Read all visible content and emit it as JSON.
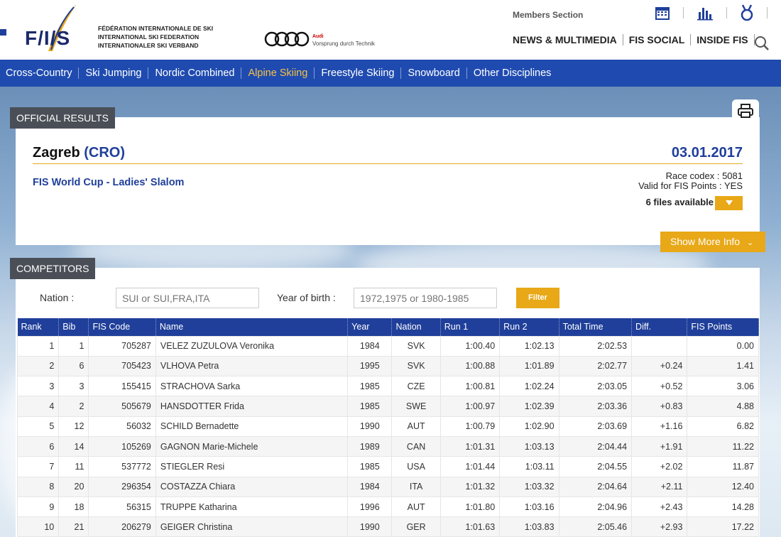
{
  "header": {
    "federation_lines": [
      "FÉDÉRATION INTERNATIONALE DE SKI",
      "INTERNATIONAL SKI FEDERATION",
      "INTERNATIONALER SKI VERBAND"
    ],
    "logo_text": "F/I/S",
    "sponsor_brand": "Audi",
    "sponsor_tagline": "Vorsprung durch Technik",
    "members_section": "Members Section",
    "nav": [
      "NEWS & MULTIMEDIA",
      "FIS SOCIAL",
      "INSIDE FIS"
    ],
    "icons": [
      "calendar-icon",
      "bar-chart-icon",
      "medal-icon",
      "user-icon",
      "search-icon"
    ]
  },
  "disciplines": [
    {
      "label": "Cross-Country",
      "active": false
    },
    {
      "label": "Ski Jumping",
      "active": false
    },
    {
      "label": "Nordic Combined",
      "active": false
    },
    {
      "label": "Alpine Skiing",
      "active": true
    },
    {
      "label": "Freestyle Skiing",
      "active": false
    },
    {
      "label": "Snowboard",
      "active": false
    },
    {
      "label": "Other Disciplines",
      "active": false
    }
  ],
  "official": {
    "tab": "OFFICIAL RESULTS",
    "place": "Zagreb",
    "country": "(CRO)",
    "date": "03.01.2017",
    "event": "FIS World Cup - Ladies' Slalom",
    "codex": "Race codex : 5081",
    "valid": "Valid for FIS Points : YES",
    "files": "6 files available",
    "more": "Show More Info"
  },
  "competitors": {
    "tab": "COMPETITORS",
    "nation_label": "Nation :",
    "nation_placeholder": "SUI or SUI,FRA,ITA",
    "yob_label": "Year of birth :",
    "yob_placeholder": "1972,1975 or 1980-1985",
    "filter": "Filter",
    "columns": [
      "Rank",
      "Bib",
      "FIS Code",
      "Name",
      "Year",
      "Nation",
      "Run 1",
      "Run 2",
      "Total Time",
      "Diff.",
      "FIS Points"
    ],
    "rows": [
      [
        "1",
        "1",
        "705287",
        "VELEZ ZUZULOVA Veronika",
        "1984",
        "SVK",
        "1:00.40",
        "1:02.13",
        "2:02.53",
        "",
        "0.00"
      ],
      [
        "2",
        "6",
        "705423",
        "VLHOVA Petra",
        "1995",
        "SVK",
        "1:00.88",
        "1:01.89",
        "2:02.77",
        "+0.24",
        "1.41"
      ],
      [
        "3",
        "3",
        "155415",
        "STRACHOVA Sarka",
        "1985",
        "CZE",
        "1:00.81",
        "1:02.24",
        "2:03.05",
        "+0.52",
        "3.06"
      ],
      [
        "4",
        "2",
        "505679",
        "HANSDOTTER Frida",
        "1985",
        "SWE",
        "1:00.97",
        "1:02.39",
        "2:03.36",
        "+0.83",
        "4.88"
      ],
      [
        "5",
        "12",
        "56032",
        "SCHILD Bernadette",
        "1990",
        "AUT",
        "1:00.79",
        "1:02.90",
        "2:03.69",
        "+1.16",
        "6.82"
      ],
      [
        "6",
        "14",
        "105269",
        "GAGNON Marie-Michele",
        "1989",
        "CAN",
        "1:01.31",
        "1:03.13",
        "2:04.44",
        "+1.91",
        "11.22"
      ],
      [
        "7",
        "11",
        "537772",
        "STIEGLER Resi",
        "1985",
        "USA",
        "1:01.44",
        "1:03.11",
        "2:04.55",
        "+2.02",
        "11.87"
      ],
      [
        "8",
        "20",
        "296354",
        "COSTAZZA Chiara",
        "1984",
        "ITA",
        "1:01.32",
        "1:03.32",
        "2:04.64",
        "+2.11",
        "12.40"
      ],
      [
        "9",
        "18",
        "56315",
        "TRUPPE Katharina",
        "1996",
        "AUT",
        "1:01.80",
        "1:03.16",
        "2:04.96",
        "+2.43",
        "14.28"
      ],
      [
        "10",
        "21",
        "206279",
        "GEIGER Christina",
        "1990",
        "GER",
        "1:01.63",
        "1:03.83",
        "2:05.46",
        "+2.93",
        "17.22"
      ]
    ]
  }
}
